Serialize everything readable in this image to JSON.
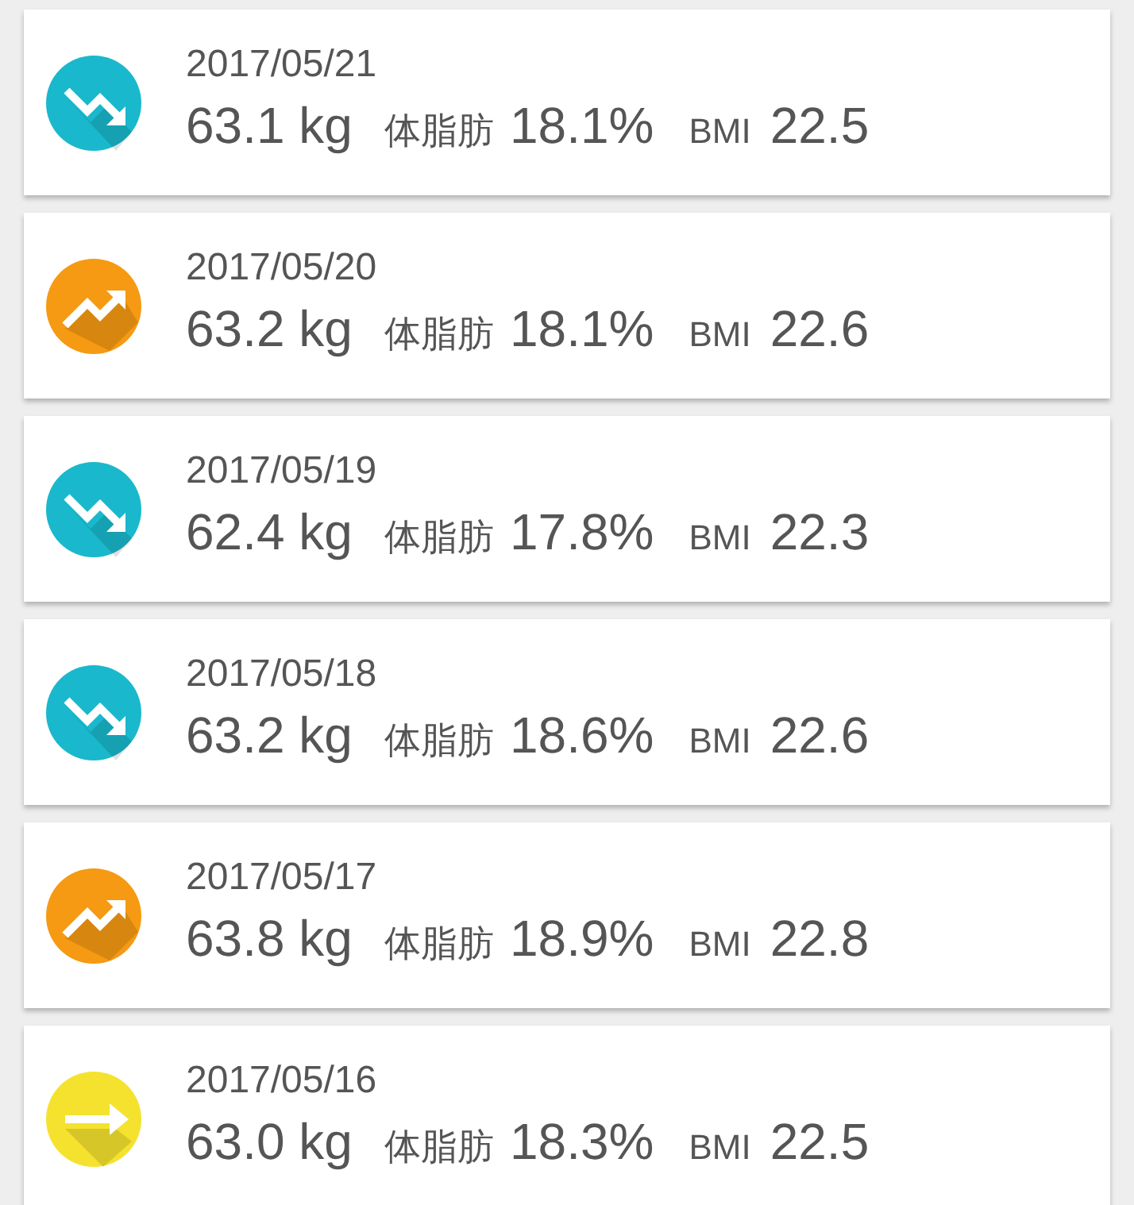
{
  "entries": [
    {
      "date": "2017/05/21",
      "weight": "63.1 kg",
      "fat_label": "体脂肪",
      "fat": "18.1%",
      "bmi_label": "BMI",
      "bmi": "22.5",
      "kind": "down",
      "color": "#1ab8cc"
    },
    {
      "date": "2017/05/20",
      "weight": "63.2 kg",
      "fat_label": "体脂肪",
      "fat": "18.1%",
      "bmi_label": "BMI",
      "bmi": "22.6",
      "kind": "up",
      "color": "#f59a12"
    },
    {
      "date": "2017/05/19",
      "weight": "62.4 kg",
      "fat_label": "体脂肪",
      "fat": "17.8%",
      "bmi_label": "BMI",
      "bmi": "22.3",
      "kind": "down",
      "color": "#1ab8cc"
    },
    {
      "date": "2017/05/18",
      "weight": "63.2 kg",
      "fat_label": "体脂肪",
      "fat": "18.6%",
      "bmi_label": "BMI",
      "bmi": "22.6",
      "kind": "down",
      "color": "#1ab8cc"
    },
    {
      "date": "2017/05/17",
      "weight": "63.8 kg",
      "fat_label": "体脂肪",
      "fat": "18.9%",
      "bmi_label": "BMI",
      "bmi": "22.8",
      "kind": "up",
      "color": "#f59a12"
    },
    {
      "date": "2017/05/16",
      "weight": "63.0 kg",
      "fat_label": "体脂肪",
      "fat": "18.3%",
      "bmi_label": "BMI",
      "bmi": "22.5",
      "kind": "flat",
      "color": "#f5e22e"
    }
  ]
}
